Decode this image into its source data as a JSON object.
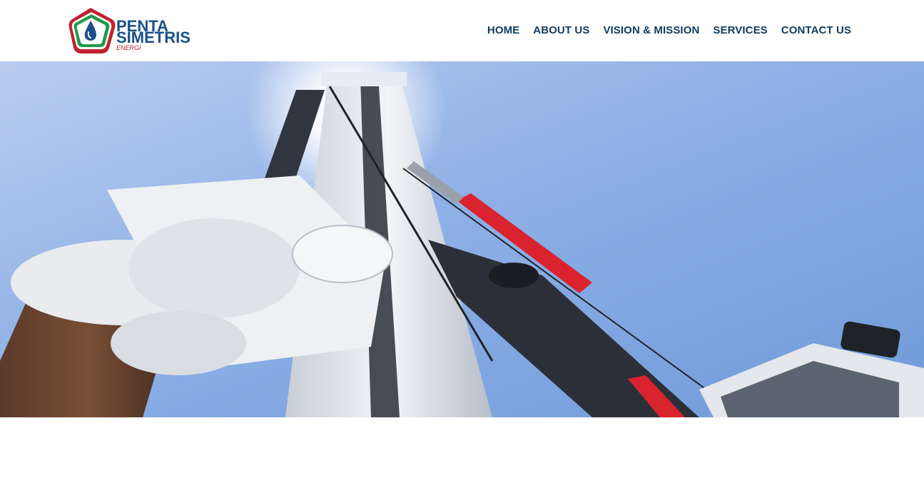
{
  "brand": {
    "line1": "PENTA",
    "line2": "SIMETRIS",
    "line3": "ENERGI",
    "icon": "oil-drop-pentagon-logo"
  },
  "nav": {
    "items": [
      {
        "label": "HOME"
      },
      {
        "label": "ABOUT US"
      },
      {
        "label": "VISION & MISSION"
      },
      {
        "label": "SERVICES"
      },
      {
        "label": "CONTACT US"
      }
    ]
  },
  "hero": {
    "image": "drilling-rig-under-blue-sky"
  },
  "colors": {
    "nav_text": "#123c64",
    "brand_blue": "#1a4f8c",
    "brand_red": "#c0222e",
    "brand_green": "#1e9a4a",
    "sky": "#7aa6e0"
  }
}
